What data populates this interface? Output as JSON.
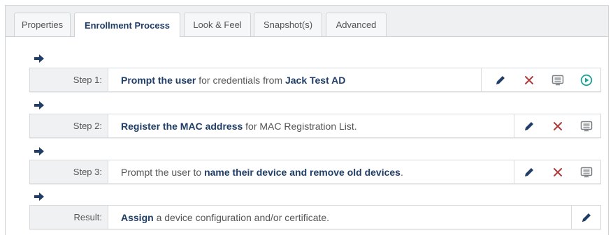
{
  "tabs": [
    {
      "label": "Properties",
      "active": false
    },
    {
      "label": "Enrollment Process",
      "active": true
    },
    {
      "label": "Look & Feel",
      "active": false
    },
    {
      "label": "Snapshot(s)",
      "active": false
    },
    {
      "label": "Advanced",
      "active": false
    }
  ],
  "steps": [
    {
      "label": "Step 1:",
      "parts": [
        {
          "text": "Prompt the user",
          "bold": true
        },
        {
          "text": " for credentials from ",
          "bold": false
        },
        {
          "text": "Jack Test AD",
          "bold": true
        }
      ],
      "actions": [
        "edit-icon",
        "delete-icon",
        "message-icon",
        "run-icon"
      ]
    },
    {
      "label": "Step 2:",
      "parts": [
        {
          "text": "Register the MAC address",
          "bold": true
        },
        {
          "text": " for MAC Registration List.",
          "bold": false
        }
      ],
      "actions": [
        "edit-icon",
        "delete-icon",
        "message-icon"
      ]
    },
    {
      "label": "Step 3:",
      "parts": [
        {
          "text": "Prompt the user to ",
          "bold": false
        },
        {
          "text": "name their device and remove old devices",
          "bold": true
        },
        {
          "text": ".",
          "bold": false
        }
      ],
      "actions": [
        "edit-icon",
        "delete-icon",
        "message-icon"
      ]
    },
    {
      "label": "Result:",
      "parts": [
        {
          "text": "Assign",
          "bold": true
        },
        {
          "text": " a device configuration and/or certificate.",
          "bold": false
        }
      ],
      "actions": [
        "edit-icon"
      ]
    }
  ],
  "colors": {
    "edit": "#1f3d66",
    "delete": "#b03a3a",
    "message": "#7a7f84",
    "run": "#1aa39a",
    "arrow": "#1f3d66"
  }
}
